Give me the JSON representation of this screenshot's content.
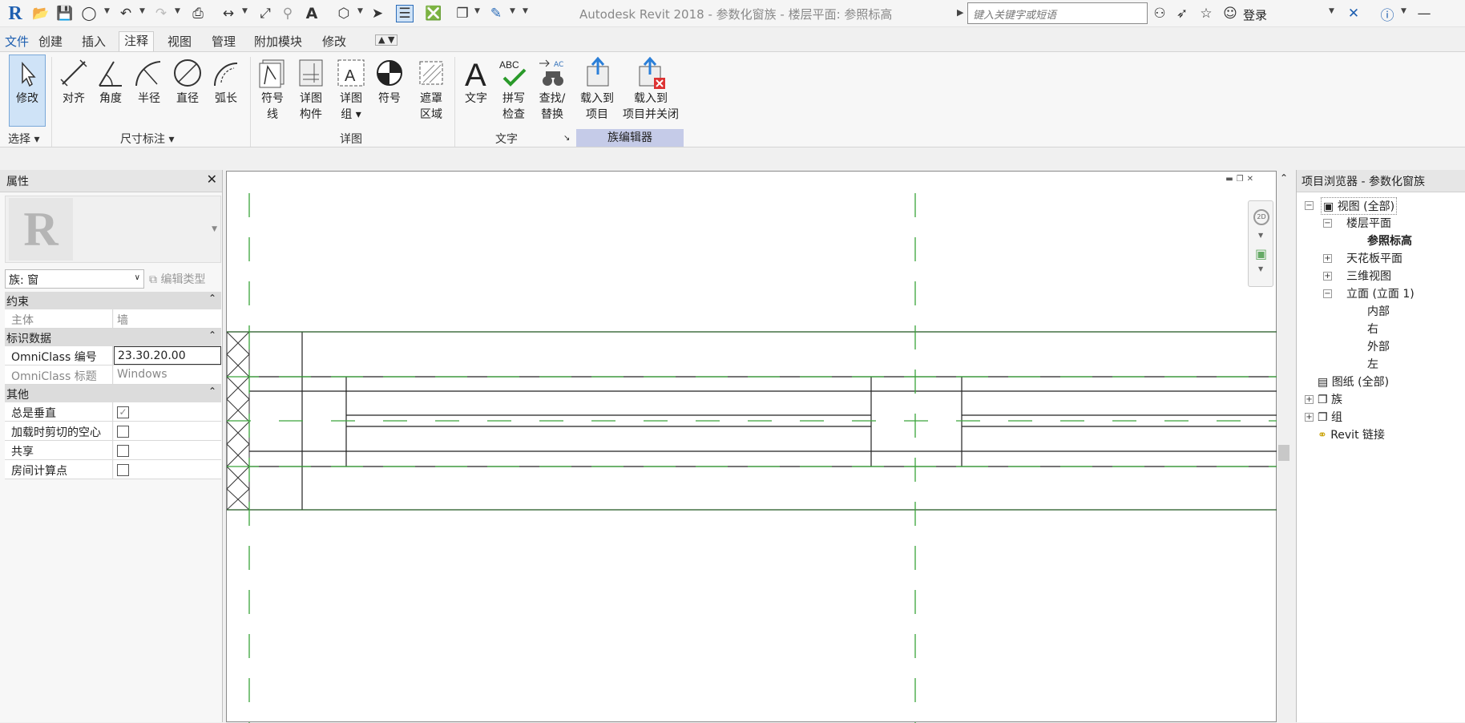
{
  "app": {
    "title": "Autodesk Revit 2018 -    参数化窗族 - 楼层平面: 参照标高",
    "search_placeholder": "键入关键字或短语",
    "login_label": "登录",
    "logo_letter": "R"
  },
  "menu": {
    "tabs": [
      "文件",
      "创建",
      "插入",
      "注释",
      "视图",
      "管理",
      "附加模块",
      "修改"
    ],
    "active": "注释"
  },
  "ribbon": {
    "modify": "修改",
    "select": "选择",
    "dim": {
      "align": "对齐",
      "angle": "角度",
      "radius": "半径",
      "diameter": "直径",
      "arc": "弧长",
      "panel": "尺寸标注"
    },
    "detail": {
      "symbol_line_1": "符号",
      "symbol_line_2": "线",
      "component_1": "详图",
      "component_2": "构件",
      "group_1": "详图",
      "group_2": "组",
      "symbol": "符号",
      "region_1": "遮罩",
      "region_2": "区域",
      "panel": "详图"
    },
    "text": {
      "text": "文字",
      "spell_1": "拼写",
      "spell_2": "检查",
      "find_1": "查找/",
      "find_2": "替换",
      "panel": "文字",
      "abc": "ABC"
    },
    "family": {
      "load_1": "载入到",
      "load_2": "项目",
      "loadclose_1": "载入到",
      "loadclose_2": "项目并关闭",
      "panel": "族编辑器"
    }
  },
  "properties": {
    "header": "属性",
    "type_select": "族: 窗",
    "edit_type": "编辑类型",
    "sections": {
      "constraints": "约束",
      "identity": "标识数据",
      "other": "其他"
    },
    "rows": {
      "host_k": "主体",
      "host_v": "墙",
      "omni_num_k": "OmniClass 编号",
      "omni_num_v": "23.30.20.00",
      "omni_title_k": "OmniClass 标题",
      "omni_title_v": "Windows",
      "always_vertical": "总是垂直",
      "cut_void": "加载时剪切的空心",
      "shared": "共享",
      "room_point": "房间计算点"
    },
    "checks": {
      "always_vertical": true,
      "cut_void": false,
      "shared": false,
      "room_point": false
    }
  },
  "browser": {
    "header": "项目浏览器 - 参数化窗族",
    "views": "视图 (全部)",
    "floor_plans": "楼层平面",
    "ref_level": "参照标高",
    "ceiling_plans": "天花板平面",
    "views_3d": "三维视图",
    "elevations": "立面 (立面 1)",
    "interior": "内部",
    "right": "右",
    "exterior": "外部",
    "left": "左",
    "sheets": "图纸 (全部)",
    "families": "族",
    "groups": "组",
    "revit_links": "Revit 链接"
  },
  "nav": {
    "label_2d": "2D"
  },
  "colors": {
    "accent": "#2b6cb8",
    "ref_line": "#3aa53a",
    "ribbon_active": "#cfe3f7",
    "family_panel": "#c5cbe8"
  }
}
